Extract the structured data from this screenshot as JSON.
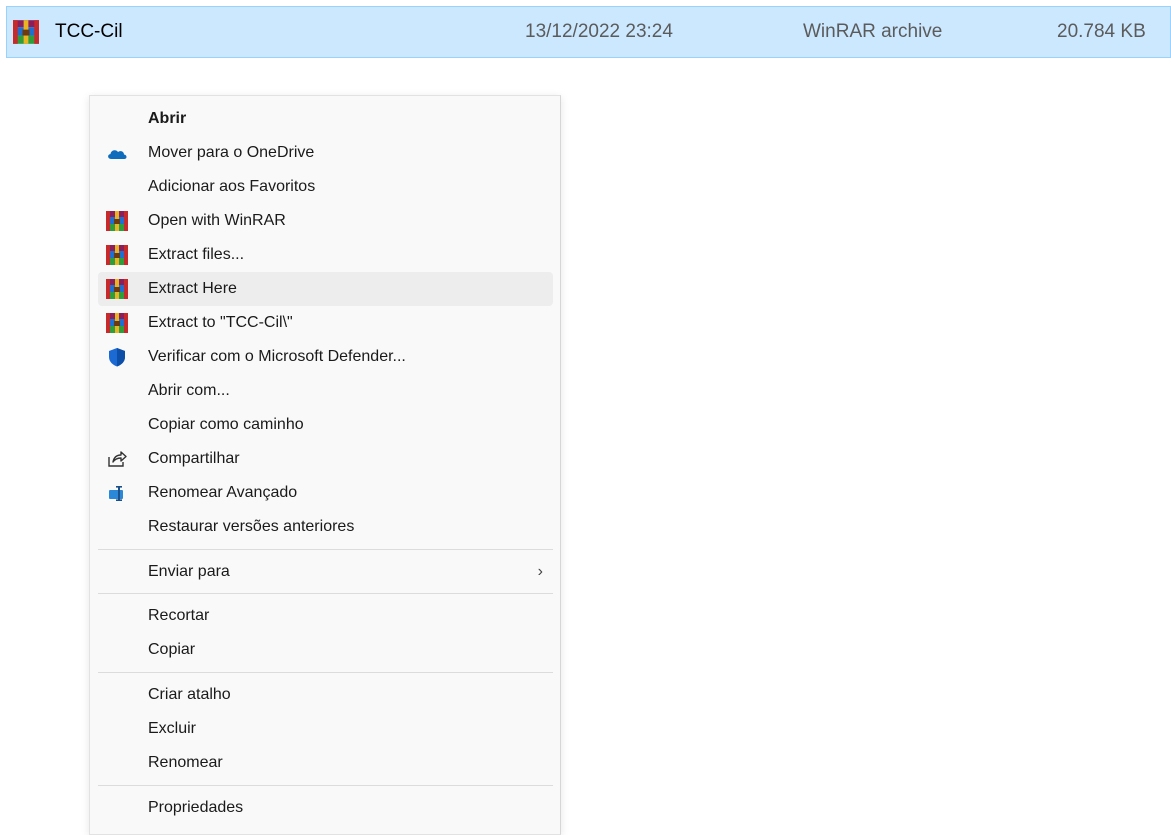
{
  "file_row": {
    "name": "TCC-Cil",
    "date": "13/12/2022 23:24",
    "type": "WinRAR archive",
    "size": "20.784 KB",
    "icon": "winrar-archive-icon"
  },
  "menu": {
    "items": [
      {
        "label": "Abrir",
        "icon": ""
      },
      {
        "label": "Mover para o OneDrive",
        "icon": "onedrive-cloud-icon"
      },
      {
        "label": "Adicionar aos Favoritos",
        "icon": ""
      },
      {
        "label": "Open with WinRAR",
        "icon": "winrar-icon"
      },
      {
        "label": "Extract files...",
        "icon": "winrar-icon"
      },
      {
        "label": "Extract Here",
        "icon": "winrar-icon"
      },
      {
        "label": "Extract to \"TCC-Cil\\\"",
        "icon": "winrar-icon"
      },
      {
        "label": "Verificar com o Microsoft Defender...",
        "icon": "defender-shield-icon"
      },
      {
        "label": "Abrir com...",
        "icon": ""
      },
      {
        "label": "Copiar como caminho",
        "icon": ""
      },
      {
        "label": "Compartilhar",
        "icon": "share-icon"
      },
      {
        "label": "Renomear Avançado",
        "icon": "power-rename-icon"
      },
      {
        "label": "Restaurar versões anteriores",
        "icon": ""
      },
      {
        "label": "Enviar para",
        "icon": "chevron-right-icon"
      },
      {
        "label": "Recortar",
        "icon": ""
      },
      {
        "label": "Copiar",
        "icon": ""
      },
      {
        "label": "Criar atalho",
        "icon": ""
      },
      {
        "label": "Excluir",
        "icon": ""
      },
      {
        "label": "Renomear",
        "icon": ""
      },
      {
        "label": "Propriedades",
        "icon": ""
      }
    ],
    "hovered": "Extract Here",
    "submenu_glyph": "›"
  },
  "colors": {
    "selection_bg": "#cce8ff",
    "selection_border": "#99d1ff",
    "menu_bg": "#f9f9f9",
    "hover_bg": "#ededed",
    "onedrive_blue": "#0f6cbd",
    "defender_blue": "#1b6ad3"
  }
}
